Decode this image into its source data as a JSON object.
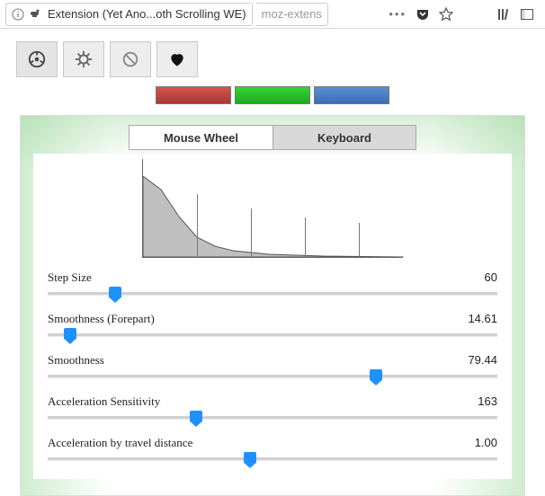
{
  "chrome": {
    "page_title": "Extension (Yet Ano...oth Scrolling WE)",
    "url_scheme": "moz-extens"
  },
  "toolbar_icons": [
    "wheel",
    "gear",
    "forbidden",
    "heart"
  ],
  "rgb": [
    "red",
    "green",
    "blue"
  ],
  "tabs": {
    "left": "Mouse Wheel",
    "right": "Keyboard",
    "active": "right"
  },
  "chart_data": {
    "type": "area",
    "title": "",
    "xlabel": "",
    "ylabel": "",
    "xlim": [
      0,
      290
    ],
    "ylim": [
      0,
      90
    ],
    "vlines_x": [
      60,
      120,
      180,
      240
    ],
    "vlines_height": [
      70,
      54,
      44,
      38
    ],
    "x": [
      0,
      20,
      40,
      60,
      80,
      100,
      140,
      200,
      290
    ],
    "y": [
      90,
      75,
      45,
      22,
      12,
      7,
      3,
      1,
      0
    ]
  },
  "sliders": [
    {
      "label": "Step Size",
      "value": "60",
      "pos_pct": 15
    },
    {
      "label": "Smoothness (Forepart)",
      "value": "14.61",
      "pos_pct": 5
    },
    {
      "label": "Smoothness",
      "value": "79.44",
      "pos_pct": 73
    },
    {
      "label": "Acceleration Sensitivity",
      "value": "163",
      "pos_pct": 33
    },
    {
      "label": "Acceleration by travel distance",
      "value": "1.00",
      "pos_pct": 45
    }
  ]
}
